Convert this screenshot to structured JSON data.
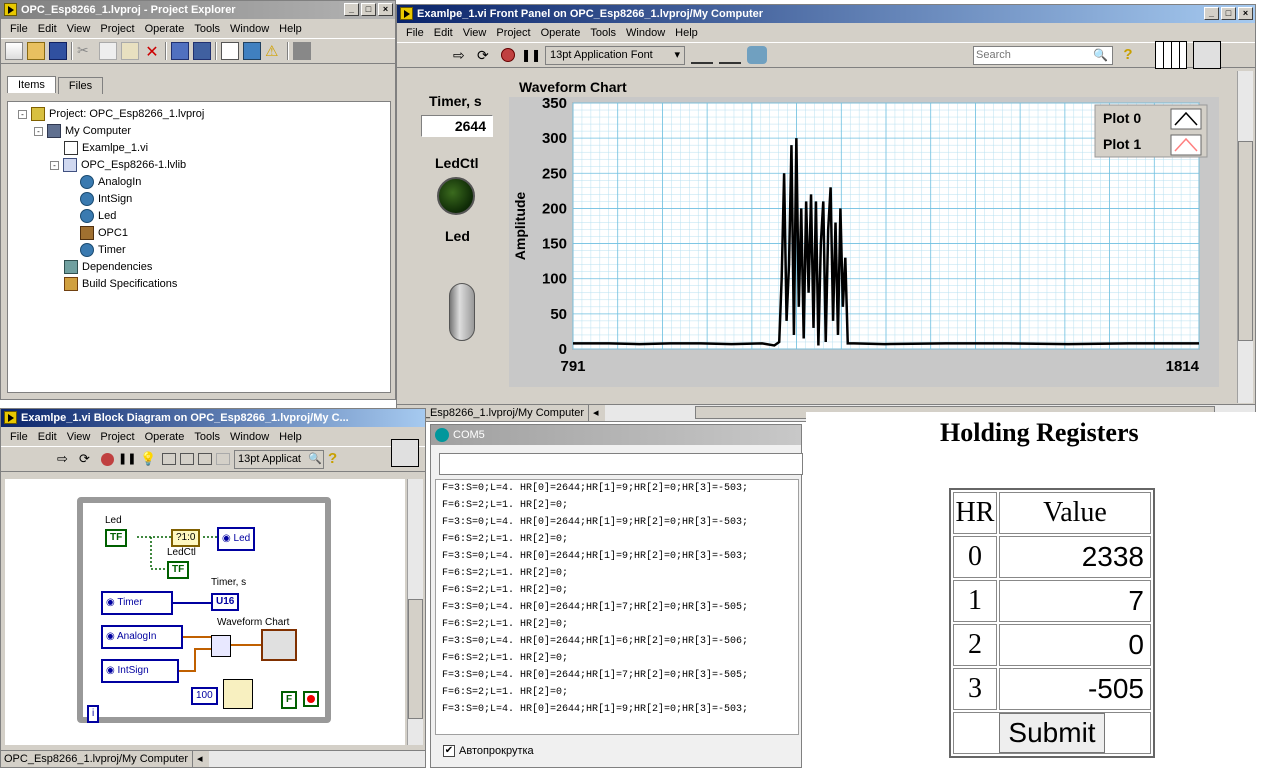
{
  "project_explorer": {
    "title": "OPC_Esp8266_1.lvproj - Project Explorer",
    "menu": [
      "File",
      "Edit",
      "View",
      "Project",
      "Operate",
      "Tools",
      "Window",
      "Help"
    ],
    "tabs": [
      "Items",
      "Files"
    ],
    "tree": [
      {
        "label": "Project: OPC_Esp8266_1.lvproj",
        "level": 0,
        "icon": "project-icon"
      },
      {
        "label": "My Computer",
        "level": 1,
        "icon": "computer-icon"
      },
      {
        "label": "Examlpe_1.vi",
        "level": 2,
        "icon": "vi-icon"
      },
      {
        "label": "OPC_Esp8266-1.lvlib",
        "level": 2,
        "icon": "library-icon"
      },
      {
        "label": "AnalogIn",
        "level": 3,
        "icon": "variable-icon"
      },
      {
        "label": "IntSign",
        "level": 3,
        "icon": "variable-icon"
      },
      {
        "label": "Led",
        "level": 3,
        "icon": "variable-icon"
      },
      {
        "label": "OPC1",
        "level": 3,
        "icon": "io-server-icon"
      },
      {
        "label": "Timer",
        "level": 3,
        "icon": "variable-icon"
      },
      {
        "label": "Dependencies",
        "level": 2,
        "icon": "dependencies-icon"
      },
      {
        "label": "Build Specifications",
        "level": 2,
        "icon": "build-icon"
      }
    ]
  },
  "front_panel": {
    "title": "Examlpe_1.vi Front Panel on OPC_Esp8266_1.lvproj/My Computer",
    "menu": [
      "File",
      "Edit",
      "View",
      "Project",
      "Operate",
      "Tools",
      "Window",
      "Help"
    ],
    "font_selector": "13pt Application Font",
    "search_placeholder": "Search",
    "timer_label": "Timer, s",
    "timer_value": "2644",
    "ledctl_label": "LedCtl",
    "led_label": "Led",
    "chart_title": "Waveform Chart",
    "status_path": "OPC_Esp8266_1.lvproj/My Computer"
  },
  "chart_data": {
    "type": "line",
    "title": "Waveform Chart",
    "xlabel": "",
    "ylabel": "Amplitude",
    "xlim": [
      791,
      1814
    ],
    "ylim": [
      0,
      350
    ],
    "yticks": [
      "350",
      "300",
      "250",
      "200",
      "150",
      "100",
      "50",
      "0"
    ],
    "xticks": [
      "791",
      "1814"
    ],
    "grid": true,
    "legend": "top-right",
    "series": [
      {
        "name": "Plot 0",
        "color": "#000000",
        "x": [
          791,
          850,
          900,
          950,
          1000,
          1050,
          1100,
          1120,
          1128,
          1132,
          1136,
          1140,
          1144,
          1148,
          1152,
          1156,
          1160,
          1164,
          1168,
          1172,
          1176,
          1180,
          1184,
          1188,
          1192,
          1196,
          1200,
          1204,
          1208,
          1212,
          1216,
          1220,
          1224,
          1228,
          1232,
          1236,
          1240,
          1250,
          1300,
          1400,
          1500,
          1600,
          1700,
          1814
        ],
        "values": [
          8,
          8,
          7,
          8,
          8,
          7,
          8,
          5,
          10,
          100,
          250,
          40,
          120,
          290,
          20,
          300,
          60,
          200,
          15,
          210,
          80,
          220,
          30,
          210,
          5,
          150,
          210,
          10,
          170,
          230,
          40,
          180,
          20,
          200,
          60,
          130,
          8,
          8,
          7,
          8,
          8,
          7,
          8,
          8
        ]
      },
      {
        "name": "Plot 1",
        "color": "#ff8080",
        "x": [],
        "values": []
      }
    ]
  },
  "block_diagram": {
    "title": "Examlpe_1.vi Block Diagram on OPC_Esp8266_1.lvproj/My C...",
    "menu": [
      "File",
      "Edit",
      "View",
      "Project",
      "Operate",
      "Tools",
      "Window",
      "Help"
    ],
    "font_selector": "13pt Applicat",
    "led_label": "Led",
    "tf": "TF",
    "led_node": "Led",
    "ledctl_label": "LedCtl",
    "tf2": "TF",
    "timer_label": "Timer, s",
    "timer_node": "Timer",
    "u16": "U16",
    "chart_label": "Waveform Chart",
    "analogin_node": "AnalogIn",
    "intsign_node": "IntSign",
    "const_100": "100",
    "false_const": "F",
    "case_sel": "?1:0",
    "info": "i",
    "status_path": "OPC_Esp8266_1.lvproj/My Computer"
  },
  "serial_monitor": {
    "title": "COM5",
    "lines": [
      "F=3:S=0;L=4. HR[0]=2644;HR[1]=9;HR[2]=0;HR[3]=-503;",
      "F=6:S=2;L=1. HR[2]=0;",
      "F=3:S=0;L=4. HR[0]=2644;HR[1]=9;HR[2]=0;HR[3]=-503;",
      "F=6:S=2;L=1. HR[2]=0;",
      "F=3:S=0;L=4. HR[0]=2644;HR[1]=9;HR[2]=0;HR[3]=-503;",
      "F=6:S=2;L=1. HR[2]=0;",
      "F=6:S=2;L=1. HR[2]=0;",
      "F=3:S=0;L=4. HR[0]=2644;HR[1]=7;HR[2]=0;HR[3]=-505;",
      "F=6:S=2;L=1. HR[2]=0;",
      "F=3:S=0;L=4. HR[0]=2644;HR[1]=6;HR[2]=0;HR[3]=-506;",
      "F=6:S=2;L=1. HR[2]=0;",
      "F=3:S=0;L=4. HR[0]=2644;HR[1]=7;HR[2]=0;HR[3]=-505;",
      "F=6:S=2;L=1. HR[2]=0;",
      "F=3:S=0;L=4. HR[0]=2644;HR[1]=9;HR[2]=0;HR[3]=-503;"
    ],
    "autoscroll_label": "Автопрокрутка"
  },
  "holding_registers": {
    "heading": "Holding Registers",
    "col_hr": "HR",
    "col_value": "Value",
    "rows": [
      {
        "hr": "0",
        "value": "2338"
      },
      {
        "hr": "1",
        "value": "7"
      },
      {
        "hr": "2",
        "value": "0"
      },
      {
        "hr": "3",
        "value": "-505"
      }
    ],
    "submit": "Submit"
  }
}
